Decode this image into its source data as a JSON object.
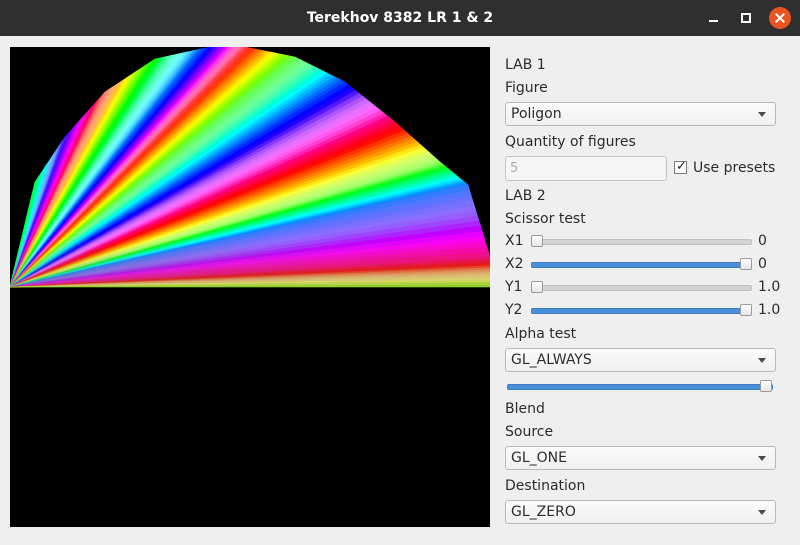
{
  "window": {
    "title": "Terekhov 8382 LR 1 & 2"
  },
  "controls_icons": {
    "minimize": "minimize-icon",
    "maximize": "maximize-icon",
    "close": "close-icon"
  },
  "lab1": {
    "heading": "LAB 1",
    "figure_label": "Figure",
    "figure_value": "Poligon",
    "quantity_label": "Quantity of figures",
    "quantity_value": "5",
    "use_presets_label": "Use presets",
    "use_presets_checked": true
  },
  "lab2": {
    "heading": "LAB 2",
    "scissor_label": "Scissor test",
    "sliders": [
      {
        "name": "X1",
        "value": "0",
        "level": 0.0
      },
      {
        "name": "X2",
        "value": "0",
        "level": 1.0
      },
      {
        "name": "Y1",
        "value": "1.0",
        "level": 0.0
      },
      {
        "name": "Y2",
        "value": "1.0",
        "level": 1.0
      }
    ],
    "alpha_label": "Alpha test",
    "alpha_value": "GL_ALWAYS",
    "alpha_level": 1.0,
    "blend_label": "Blend",
    "source_label": "Source",
    "source_value": "GL_ONE",
    "destination_label": "Destination",
    "destination_value": "GL_ZERO"
  }
}
